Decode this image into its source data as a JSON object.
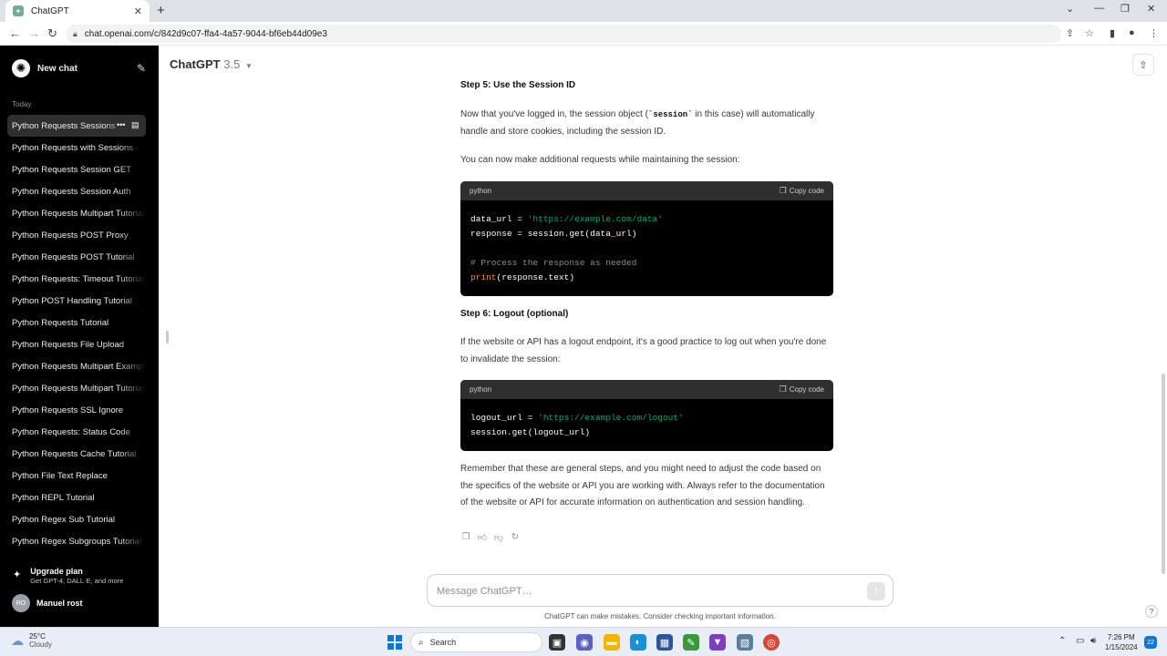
{
  "browser": {
    "tab_title": "ChatGPT",
    "tab_close": "✕",
    "new_tab": "+",
    "url": "chat.openai.com/c/842d9c07-ffa4-4a57-9044-bf6eb44d09e3"
  },
  "sidebar": {
    "new_chat": "New chat",
    "section_today": "Today",
    "chats": [
      "Python Requests Sessions",
      "Python Requests with Sessions",
      "Python Requests Session GET",
      "Python Requests Session Auth",
      "Python Requests Multipart Tutorial",
      "Python Requests POST Proxy",
      "Python Requests POST Tutorial",
      "Python Requests: Timeout Tutorial",
      "Python POST Handling Tutorial",
      "Python Requests Tutorial",
      "Python Requests File Upload",
      "Python Requests Multipart Example",
      "Python Requests Multipart Tutorial",
      "Python Requests SSL Ignore",
      "Python Requests: Status Code",
      "Python Requests Cache Tutorial",
      "Python File Text Replace",
      "Python REPL Tutorial",
      "Python Regex Sub Tutorial",
      "Python Regex Subgroups Tutorial"
    ],
    "upgrade_title": "Upgrade plan",
    "upgrade_sub": "Get GPT-4, DALL·E, and more",
    "user_initials": "RO",
    "user_name": "Manuel rost"
  },
  "header": {
    "model_name": "ChatGPT",
    "model_version": "3.5"
  },
  "message": {
    "step5_title": "Step 5: Use the Session ID",
    "step5_p1_before": "Now that you've logged in, the session object (",
    "step5_p1_code": "`session`",
    "step5_p1_after": " in this case) will automatically handle and store cookies, including the session ID.",
    "step5_p2": "You can now make additional requests while maintaining the session:",
    "code1": {
      "lang": "python",
      "copy_label": "Copy code",
      "l1_var": "data_url = ",
      "l1_str": "'https://example.com/data'",
      "l2": "response = session.get(data_url)",
      "l4": "# Process the response as needed",
      "l5_fn": "print",
      "l5_rest": "(response.text)"
    },
    "step6_title": "Step 6: Logout (optional)",
    "step6_p1": "If the website or API has a logout endpoint, it's a good practice to log out when you're done to invalidate the session:",
    "code2": {
      "lang": "python",
      "copy_label": "Copy code",
      "l1_var": "logout_url = ",
      "l1_str": "'https://example.com/logout'",
      "l2": "session.get(logout_url)"
    },
    "closing": "Remember that these are general steps, and you might need to adjust the code based on the specifics of the website or API you are working with. Always refer to the documentation of the website or API for accurate information on authentication and session handling."
  },
  "composer": {
    "placeholder": "Message ChatGPT…",
    "disclaimer": "ChatGPT can make mistakes. Consider checking important information.",
    "help": "?"
  },
  "taskbar": {
    "temp": "25°C",
    "condition": "Cloudy",
    "search": "Search",
    "time": "7:26 PM",
    "date": "1/15/2024",
    "notifications": "22"
  }
}
